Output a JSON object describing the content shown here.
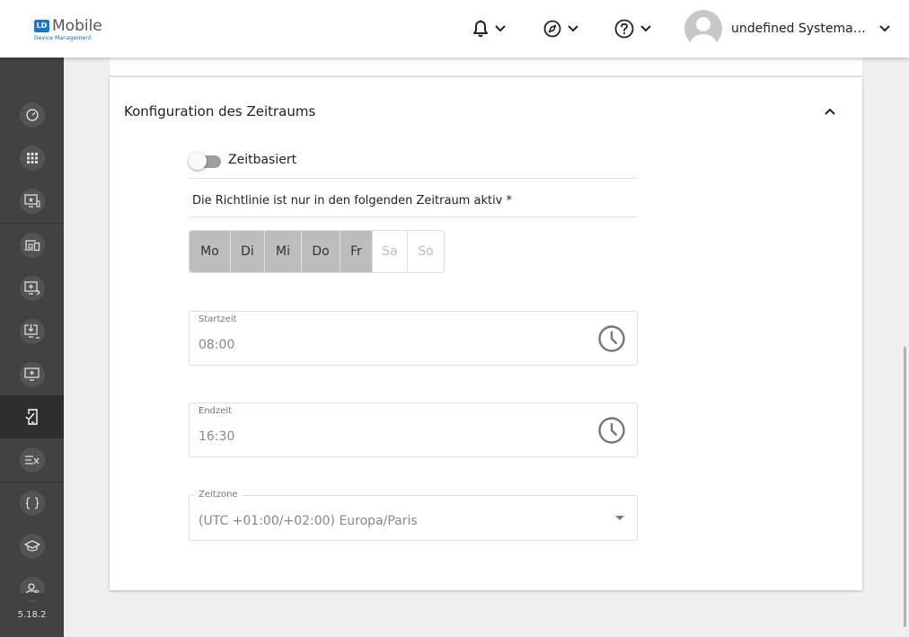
{
  "header": {
    "logo_badge": "LD",
    "logo_main": "Mobile",
    "logo_sub": "Device Management",
    "user_name": "undefined Systemadmi..."
  },
  "icons": {
    "notifications": "bell-icon",
    "messages": "compass-icon",
    "help": "help-icon",
    "user_menu": "chevron-down-icon"
  },
  "sidebar": {
    "items": [
      {
        "name": "dashboard",
        "icon": "speedometer-icon"
      },
      {
        "name": "apps",
        "icon": "grid-icon"
      },
      {
        "name": "remote",
        "icon": "monitor-star-icon"
      },
      {
        "name": "devices",
        "icon": "devices-icon"
      },
      {
        "name": "deploy",
        "icon": "monitor-plus-arrow-icon"
      },
      {
        "name": "install",
        "icon": "monitor-download-icon"
      },
      {
        "name": "add-device",
        "icon": "monitor-plus-icon"
      },
      {
        "name": "policies",
        "icon": "phone-check-icon",
        "active": true
      },
      {
        "name": "rules",
        "icon": "list-x-icon"
      },
      {
        "name": "scripts",
        "icon": "braces-icon"
      },
      {
        "name": "training",
        "icon": "graduation-cap-icon"
      },
      {
        "name": "users",
        "icon": "users-icon"
      }
    ],
    "version": "5.18.2"
  },
  "section": {
    "title": "Konfiguration des Zeitraums",
    "toggle_label": "Zeitbasiert",
    "toggle_on": false,
    "policy_label": "Die Richtlinie ist nur in den folgenden Zeitraum aktiv *"
  },
  "days": [
    {
      "label": "Mo",
      "selected": true
    },
    {
      "label": "Di",
      "selected": true
    },
    {
      "label": "Mi",
      "selected": true
    },
    {
      "label": "Do",
      "selected": true
    },
    {
      "label": "Fr",
      "selected": true
    },
    {
      "label": "Sa",
      "selected": false
    },
    {
      "label": "So",
      "selected": false
    }
  ],
  "start_time": {
    "label": "Startzeit",
    "value": "08:00"
  },
  "end_time": {
    "label": "Endzeit",
    "value": "16:30"
  },
  "timezone": {
    "label": "Zeitzone",
    "value": "(UTC +01:00/+02:00) Europa/Paris"
  },
  "colors": {
    "sidebar": "#424242",
    "sidebar_active": "#2e2e2e",
    "day_selected": "#bdbdbd",
    "accent": "#1976d2"
  }
}
